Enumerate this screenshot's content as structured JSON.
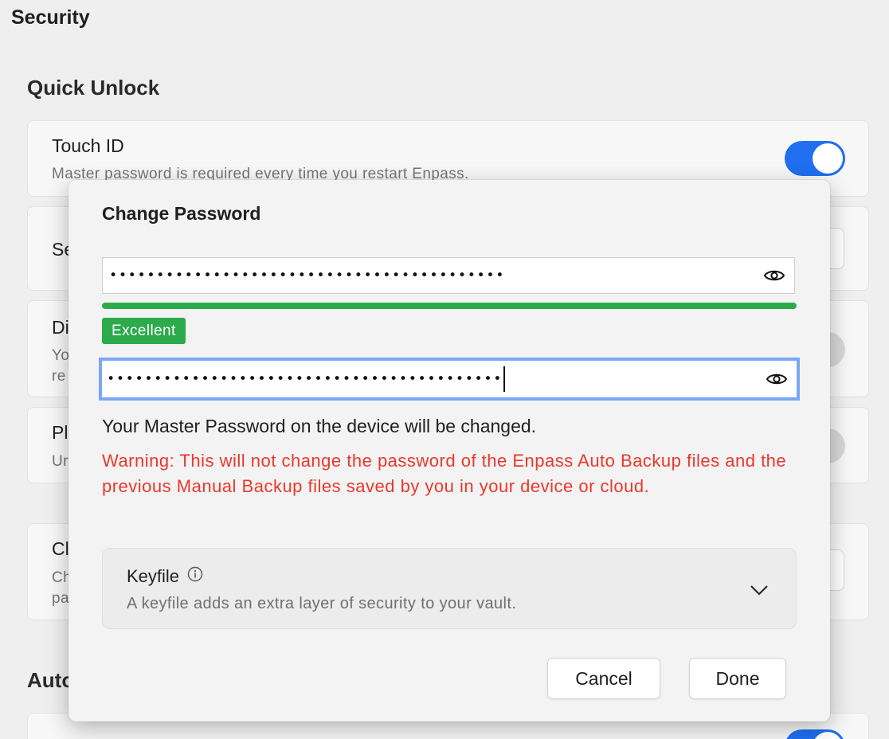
{
  "page": {
    "title": "Security"
  },
  "sections": {
    "quick_unlock": "Quick Unlock",
    "auto_lock_partial": "Auto"
  },
  "cards": {
    "touch_id": {
      "title": "Touch ID",
      "subtitle": "Master password is required every time you restart Enpass.",
      "toggle_on": true
    },
    "card2": {
      "title_partial": "Se"
    },
    "card3": {
      "title_partial": "Di",
      "sub_line1": "Yo",
      "sub_line2": "re"
    },
    "card4": {
      "title_partial": "Pl",
      "sub_partial": "Ur"
    },
    "card5": {
      "title_partial": "Cl",
      "sub_line1": "Ch",
      "sub_line2": "pa"
    }
  },
  "dialog": {
    "title": "Change Password",
    "password": "••••••••••••••••••••••••••••••••••••••••••",
    "confirm_password": "••••••••••••••••••••••••••••••••••••••••••",
    "strength_label": "Excellent",
    "strength_fraction": 1.0,
    "strength_color": "#2cab4c",
    "info": "Your Master Password on the device will be changed.",
    "warning": "Warning: This will not change the password of the Enpass Auto Backup files and the previous Manual Backup files saved by you in your device or cloud.",
    "keyfile": {
      "title": "Keyfile",
      "subtitle": "A keyfile adds an extra layer of security to your vault.",
      "icons": [
        "info-icon",
        "chevron-down-icon"
      ]
    },
    "buttons": {
      "cancel": "Cancel",
      "done": "Done"
    },
    "icons": [
      "eye-icon"
    ]
  },
  "colors": {
    "accent": "#1f6ff0",
    "warning": "#e8392d",
    "success": "#2cab4c",
    "focus_ring": "#7aa8f4"
  }
}
